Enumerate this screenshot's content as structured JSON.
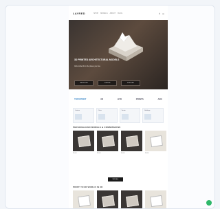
{
  "nav": {
    "logo": "LAYRED",
    "links": [
      "SHOP",
      "MODELS",
      "ABOUT",
      "BLOG"
    ],
    "icons": [
      "search-icon",
      "cart-icon"
    ]
  },
  "hero": {
    "headline": "3D PRINTED ARCHITECTURAL MODELS",
    "subline": "Gifts crafted from the places you love",
    "buttons": [
      "SHOP NOW",
      "CUSTOM",
      "EXPLORE"
    ]
  },
  "brands": [
    "TOPOPRINT",
    "3D",
    "HYD",
    "PRINTS",
    "ARC"
  ],
  "promos": [
    "Custom",
    "Cities",
    "Terrain",
    "Buildings"
  ],
  "section1": {
    "title": "PERSONALIZED MODELS & COMMISSIONS",
    "products": [
      "Model",
      "Model",
      "Model",
      "Model",
      "Model"
    ]
  },
  "more_label": "VIEW ALL",
  "section2": {
    "title": "PRINT YOUR WORLD IN 3D",
    "products": [
      "Model",
      "Model",
      "Model",
      "Model",
      "Model"
    ]
  },
  "colors": {
    "accent": "#2fb86a",
    "dark": "#1a1a1a",
    "page_bg": "#f2f5f9"
  }
}
